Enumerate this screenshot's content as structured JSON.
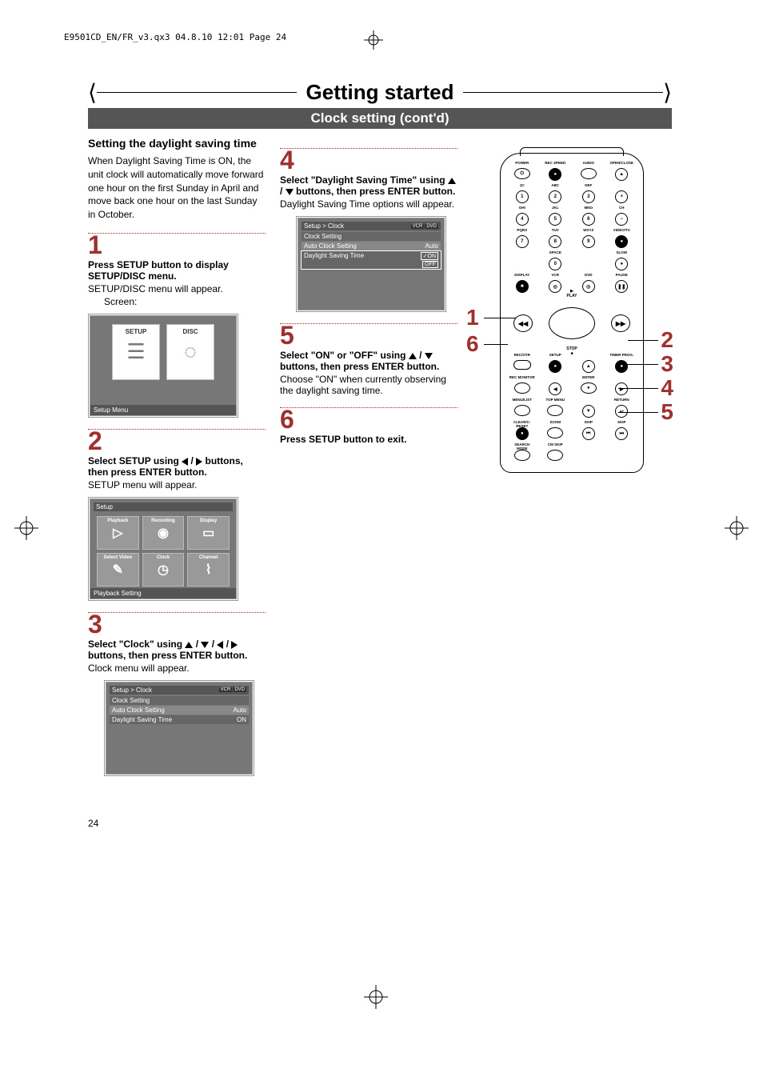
{
  "header_line": "E9501CD_EN/FR_v3.qx3  04.8.10  12:01  Page 24",
  "section_title": "Getting started",
  "subsection_title": "Clock setting (cont'd)",
  "left": {
    "heading": "Setting the daylight saving time",
    "intro": "When Daylight Saving Time is ON, the unit clock will automatically move forward one hour on the first Sunday in April and move back one hour on the last Sunday in October.",
    "step1": "1",
    "step1_bold": "Press SETUP button to display SETUP/DISC menu.",
    "step1_norm": "SETUP/DISC menu will appear.",
    "step1_screen_label": "Screen:",
    "screen1": {
      "tiles": [
        "SETUP",
        "DISC"
      ],
      "status": "Setup Menu"
    },
    "step2": "2",
    "step2_bold_pre": "Select SETUP using ",
    "step2_bold_post": " buttons, then press ENTER button.",
    "step2_norm": "SETUP menu will appear.",
    "screen2": {
      "title": "Setup",
      "cells": [
        "Playback",
        "Recording",
        "Display",
        "Select Video",
        "Clock",
        "Channel"
      ],
      "status": "Playback Setting"
    },
    "step3": "3",
    "step3_bold_pre": "Select \"Clock\" using ",
    "step3_bold_post": " buttons, then press ENTER button.",
    "step3_norm": "Clock menu will appear.",
    "screen3": {
      "breadcrumb": "Setup > Clock",
      "rows": [
        {
          "label": "Clock Setting",
          "value": ""
        },
        {
          "label": "Auto Clock Setting",
          "value": "Auto"
        },
        {
          "label": "Daylight Saving Time",
          "value": "ON"
        }
      ]
    }
  },
  "mid": {
    "step4": "4",
    "step4_bold_pre": "Select \"Daylight Saving Time\" using ",
    "step4_bold_post": " buttons, then press ENTER button.",
    "step4_norm": "Daylight Saving Time options will appear.",
    "screen4": {
      "breadcrumb": "Setup > Clock",
      "rows": [
        {
          "label": "Clock Setting",
          "value": ""
        },
        {
          "label": "Auto Clock Setting",
          "value": "Auto"
        },
        {
          "label": "Daylight Saving Time",
          "value": "",
          "options": [
            "ON",
            "OFF"
          ],
          "checked": "ON"
        }
      ]
    },
    "step5": "5",
    "step5_bold_pre": "Select \"ON\" or \"OFF\" using ",
    "step5_bold_post": " buttons, then press ENTER button.",
    "step5_norm": "Choose \"ON\" when currently observing the daylight saving time.",
    "step6": "6",
    "step6_bold": "Press SETUP button to exit."
  },
  "remote": {
    "row1": [
      "POWER",
      "REC SPEED",
      "AUDIO",
      "OPEN/CLOSE"
    ],
    "num_labels": [
      "@!",
      "ABC",
      "DEF",
      "",
      "GHI",
      "JKL",
      "MNO",
      "CH",
      "PQRS",
      "TUV",
      "WXYZ",
      "VIDEO/TV"
    ],
    "nums": [
      "1",
      "2",
      "3",
      "+",
      "4",
      "5",
      "6",
      "−",
      "7",
      "8",
      "9",
      "●"
    ],
    "space_row_labels": [
      "",
      "SPACE",
      "",
      "SLOW"
    ],
    "space_row": [
      "",
      "0",
      "",
      "●"
    ],
    "mode_row_labels": [
      "DISPLAY",
      "VCR",
      "DVD",
      "PAUSE"
    ],
    "mode_row": [
      "■",
      "◎",
      "◎",
      "❚❚"
    ],
    "dpad": {
      "play": "PLAY",
      "stop": "STOP",
      "left": "◀◀",
      "right": "▶▶"
    },
    "below1_labels": [
      "REC/OTR",
      "SETUP",
      "",
      "TIMER PROG."
    ],
    "below2_labels": [
      "REC MONITOR",
      "",
      "ENTER",
      ""
    ],
    "below3_labels": [
      "MENU/LIST",
      "TOP MENU",
      "",
      "RETURN"
    ],
    "below4_labels": [
      "CLEAR/C-RESET",
      "ZOOM",
      "SKIP",
      "SKIP"
    ],
    "below5_labels": [
      "SEARCH MODE",
      "CM SKIP",
      "",
      ""
    ]
  },
  "callouts": {
    "c1": "1",
    "c6": "6",
    "c2": "2",
    "c3": "3",
    "c4": "4",
    "c5": "5"
  },
  "vcr_dvd": {
    "vcr": "VCR",
    "dvd": "DVD"
  },
  "page_num": "24"
}
